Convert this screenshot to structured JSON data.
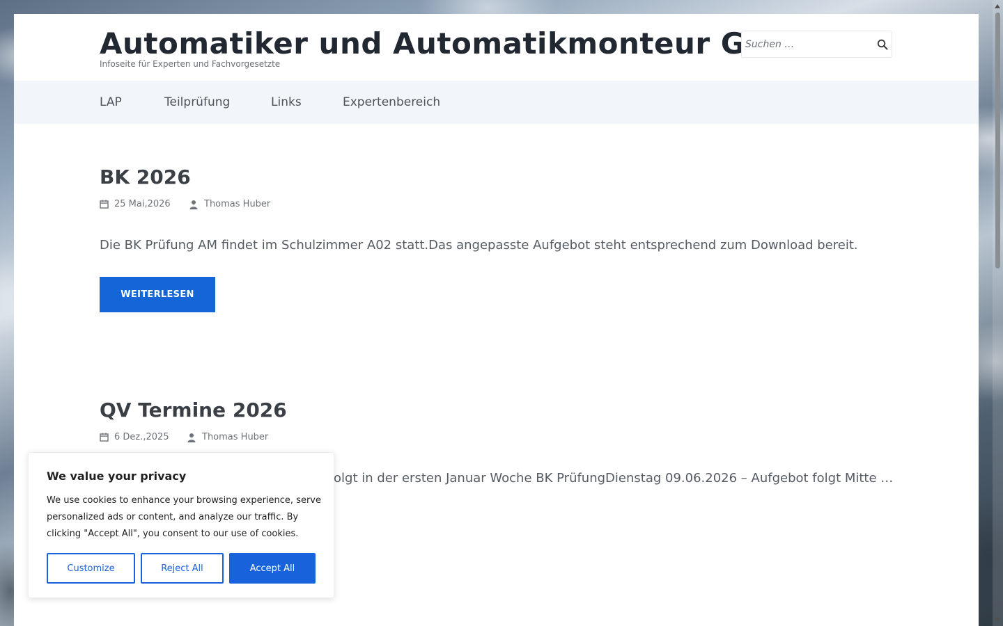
{
  "header": {
    "site_title": "Automatiker und Automatikmonteur GL",
    "site_description": "Infoseite für Experten und Fachvorgesetzte",
    "search_placeholder": "Suchen …"
  },
  "nav": {
    "items": [
      {
        "label": "LAP"
      },
      {
        "label": "Teilprüfung"
      },
      {
        "label": "Links"
      },
      {
        "label": "Expertenbereich"
      }
    ]
  },
  "posts": [
    {
      "title": "BK 2026",
      "date": "25 Mai,2026",
      "author": "Thomas Huber",
      "excerpt": "Die BK Prüfung AM findet im Schulzimmer A02 statt.Das angepasste Aufgebot steht entsprechend zum Download bereit.",
      "read_more": "WEITERLESEN"
    },
    {
      "title": "QV Termine 2026",
      "date": "6 Dez.,2025",
      "author": "Thomas Huber",
      "excerpt": "olgt in der ersten Januar Woche BK PrüfungDienstag 09.06.2026 – Aufgebot folgt Mitte …"
    }
  ],
  "cookie_banner": {
    "title": "We value your privacy",
    "text": "We use cookies to enhance your browsing experience, serve personalized ads or content, and analyze our traffic. By clicking \"Accept All\", you consent to our use of cookies.",
    "customize_label": "Customize",
    "reject_label": "Reject All",
    "accept_label": "Accept All"
  },
  "colors": {
    "accent": "#1466d8",
    "nav_background": "#f2f6fb",
    "cookie_accent": "#1863dc"
  }
}
